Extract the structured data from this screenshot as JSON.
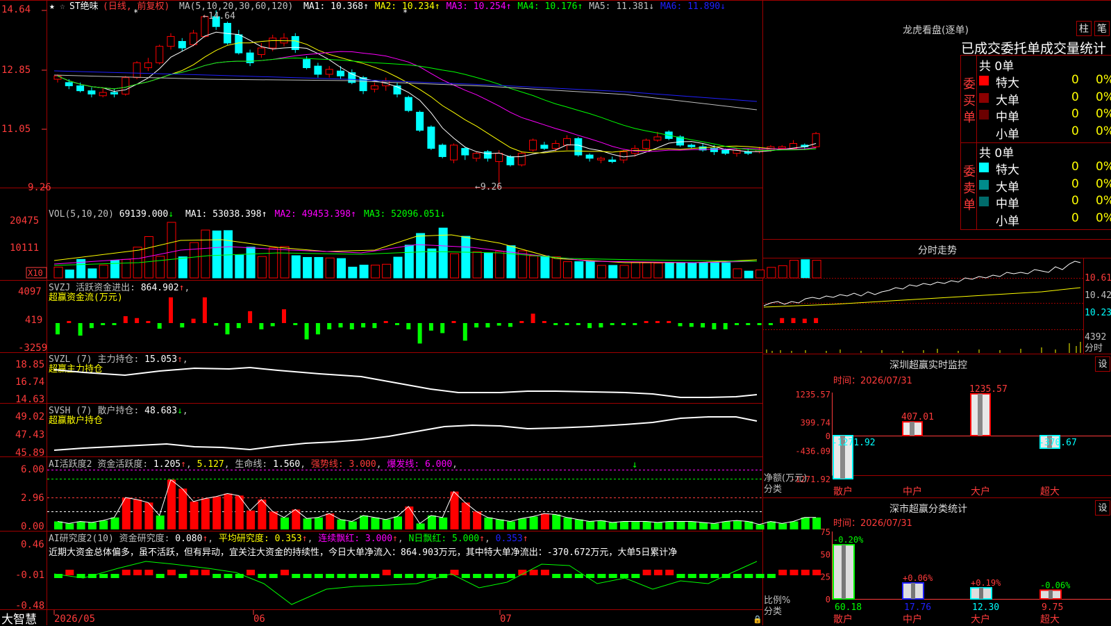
{
  "chart_data": {
    "type": "candlestick",
    "title": "ST绝味",
    "period": "日线",
    "adjust": "前复权",
    "y_ticks": [
      "14.64",
      "12.85",
      "11.05",
      "9.26"
    ],
    "high_label": "←14.64",
    "low_label": "←9.26",
    "x_ticks": [
      "2026/05",
      "06",
      "07"
    ],
    "candles": [
      [
        12.55,
        12.65,
        12.7,
        12.45
      ],
      [
        12.45,
        12.35,
        12.55,
        12.25
      ],
      [
        12.35,
        12.2,
        12.45,
        12.15
      ],
      [
        12.2,
        12.1,
        12.3,
        12.0
      ],
      [
        12.05,
        12.15,
        12.3,
        12.0
      ],
      [
        12.15,
        12.1,
        12.25,
        12.0
      ],
      [
        12.1,
        12.6,
        12.65,
        12.05
      ],
      [
        12.6,
        13.05,
        13.1,
        12.55
      ],
      [
        12.9,
        13.05,
        13.2,
        12.8
      ],
      [
        13.05,
        13.55,
        13.6,
        13.0
      ],
      [
        13.55,
        13.85,
        13.95,
        13.45
      ],
      [
        13.7,
        13.5,
        13.8,
        13.4
      ],
      [
        13.6,
        13.95,
        14.05,
        13.55
      ],
      [
        13.85,
        14.45,
        14.5,
        13.8
      ],
      [
        14.45,
        14.15,
        14.64,
        14.05
      ],
      [
        14.25,
        13.65,
        14.3,
        13.6
      ],
      [
        13.9,
        13.35,
        14.05,
        13.3
      ],
      [
        13.35,
        13.05,
        13.45,
        12.95
      ],
      [
        13.3,
        13.5,
        13.65,
        13.2
      ],
      [
        13.5,
        13.8,
        13.9,
        13.4
      ],
      [
        13.65,
        13.8,
        13.95,
        13.55
      ],
      [
        13.85,
        13.45,
        13.95,
        13.35
      ],
      [
        13.15,
        12.9,
        13.25,
        12.85
      ],
      [
        12.95,
        12.7,
        13.05,
        12.6
      ],
      [
        12.7,
        12.85,
        12.95,
        12.6
      ],
      [
        12.8,
        12.65,
        12.95,
        12.55
      ],
      [
        12.75,
        12.45,
        12.85,
        12.4
      ],
      [
        12.6,
        12.2,
        12.65,
        12.1
      ],
      [
        12.25,
        12.35,
        12.45,
        12.15
      ],
      [
        12.35,
        12.5,
        12.6,
        12.2
      ],
      [
        12.35,
        12.1,
        12.45,
        12.0
      ],
      [
        12.0,
        11.6,
        12.05,
        11.55
      ],
      [
        11.55,
        11.0,
        11.6,
        10.95
      ],
      [
        11.1,
        10.45,
        11.15,
        10.4
      ],
      [
        10.55,
        10.2,
        10.6,
        10.15
      ],
      [
        10.1,
        10.55,
        10.6,
        10.0
      ],
      [
        10.45,
        10.25,
        10.5,
        10.1
      ],
      [
        10.15,
        10.3,
        10.35,
        10.05
      ],
      [
        10.35,
        10.15,
        10.4,
        10.05
      ],
      [
        10.05,
        10.3,
        10.4,
        9.26
      ],
      [
        10.2,
        9.95,
        10.25,
        9.9
      ],
      [
        9.95,
        10.3,
        10.35,
        9.9
      ],
      [
        10.4,
        10.7,
        10.75,
        10.35
      ],
      [
        10.55,
        10.45,
        10.65,
        10.4
      ],
      [
        10.45,
        10.6,
        10.7,
        10.35
      ],
      [
        10.55,
        10.75,
        10.85,
        10.4
      ],
      [
        10.75,
        10.25,
        10.8,
        10.2
      ],
      [
        10.25,
        10.15,
        10.3,
        10.05
      ],
      [
        10.1,
        10.15,
        10.2,
        10.0
      ],
      [
        10.1,
        10.05,
        10.2,
        10.0
      ],
      [
        10.1,
        10.35,
        10.4,
        10.0
      ],
      [
        10.3,
        10.45,
        10.55,
        10.2
      ],
      [
        10.45,
        10.7,
        10.75,
        10.4
      ],
      [
        10.7,
        10.8,
        10.95,
        10.65
      ],
      [
        10.95,
        10.75,
        11.0,
        10.7
      ],
      [
        10.8,
        10.55,
        10.85,
        10.5
      ],
      [
        10.55,
        10.5,
        10.6,
        10.45
      ],
      [
        10.5,
        10.4,
        10.6,
        10.35
      ],
      [
        10.45,
        10.35,
        10.55,
        10.25
      ],
      [
        10.4,
        10.3,
        10.45,
        10.25
      ],
      [
        10.3,
        10.4,
        10.45,
        10.2
      ],
      [
        10.35,
        10.3,
        10.45,
        10.25
      ],
      [
        10.35,
        10.4,
        10.5,
        10.3
      ],
      [
        10.4,
        10.5,
        10.55,
        10.35
      ],
      [
        10.45,
        10.5,
        10.55,
        10.4
      ],
      [
        10.45,
        10.6,
        10.7,
        10.45
      ],
      [
        10.55,
        10.5,
        10.6,
        10.4
      ],
      [
        10.5,
        10.9,
        10.95,
        10.45
      ]
    ],
    "ma_header": "MA(5,10,20,30,60,120)",
    "ma": [
      {
        "name": "MA1",
        "value": "10.368",
        "arrow": "↑",
        "color": "#ffffff"
      },
      {
        "name": "MA2",
        "value": "10.234",
        "arrow": "↑",
        "color": "#ffff00"
      },
      {
        "name": "MA3",
        "value": "10.254",
        "arrow": "↑",
        "color": "#ff00ff"
      },
      {
        "name": "MA4",
        "value": "10.176",
        "arrow": "↑",
        "color": "#00ff00"
      },
      {
        "name": "MA5",
        "value": "11.381",
        "arrow": "↓",
        "color": "#c0c0c0"
      },
      {
        "name": "MA6",
        "value": "11.890",
        "arrow": "↓",
        "color": "#2020ff"
      }
    ],
    "vol": {
      "header": "VOL(5,10,20)",
      "value": "69139.000",
      "arrow": "↓",
      "ma": [
        {
          "name": "MA1",
          "value": "53038.398",
          "arrow": "↑",
          "color": "#ffffff"
        },
        {
          "name": "MA2",
          "value": "49453.398",
          "arrow": "↑",
          "color": "#ff00ff"
        },
        {
          "name": "MA3",
          "value": "52096.051",
          "arrow": "↓",
          "color": "#00ff00"
        }
      ],
      "y_ticks": [
        "20475",
        "10111"
      ],
      "unit": "X10",
      "values": [
        3800,
        2800,
        6500,
        3200,
        4500,
        6200,
        6500,
        10800,
        14500,
        7600,
        19500,
        7400,
        12400,
        16800,
        16500,
        16600,
        8000,
        10800,
        7500,
        10600,
        11000,
        7800,
        7200,
        7200,
        7000,
        6800,
        3800,
        4500,
        4500,
        4800,
        7300,
        11500,
        15600,
        10200,
        17500,
        8500,
        14600,
        9200,
        8800,
        9300,
        11300,
        9500,
        7700,
        7700,
        7400,
        5700,
        5700,
        5800,
        4400,
        4400,
        4400,
        5600,
        5300,
        5200,
        5300,
        5300,
        5300,
        5300,
        5300,
        5300,
        3200,
        2400,
        2800,
        3700,
        4300,
        6200,
        6400,
        6200
      ]
    },
    "svzj": {
      "header": "SVZJ",
      "label": "活跃资金进出",
      "value": "864.902",
      "arrow": "↑",
      "subtitle": "超赢资金流(万元)",
      "y_ticks": [
        "4097",
        "419",
        "-3259"
      ],
      "values": [
        -1800,
        0,
        -2000,
        -800,
        -200,
        -300,
        1100,
        800,
        0,
        -900,
        4097,
        -700,
        700,
        4097,
        -400,
        -1800,
        -800,
        1900,
        -1000,
        -500,
        2200,
        -300,
        -2600,
        -1800,
        -1000,
        -700,
        -1000,
        -700,
        -800,
        0,
        -300,
        -1000,
        -3259,
        -1200,
        -1600,
        0,
        -2800,
        -700,
        -700,
        -400,
        -600,
        0,
        1500,
        0,
        -200,
        -200,
        -100,
        -800,
        -700,
        -300,
        -200,
        -200,
        0,
        0,
        0,
        -500,
        -600,
        -700,
        -1000,
        -1000,
        -300,
        -200,
        -200,
        -200,
        800,
        800,
        700,
        800
      ]
    },
    "svzl": {
      "header": "SVZL (7)",
      "label": "主力持仓",
      "value": "15.053",
      "arrow": "↑",
      "subtitle": "超赢主力持仓",
      "y_ticks": [
        "18.85",
        "16.74",
        "14.63"
      ]
    },
    "svsh": {
      "header": "SVSH (7)",
      "label": "散户持仓",
      "value": "48.683",
      "arrow": "↓",
      "subtitle": "超赢散户持仓",
      "y_ticks": [
        "49.02",
        "47.43",
        "45.89"
      ]
    },
    "ai_active": {
      "header": "AI活跃度2",
      "label": "资金活跃度",
      "value1": "1.205",
      "value2": "5.127",
      "life_label": "生命线",
      "life_value": "1.560",
      "strong_label": "强势线",
      "strong_value": "3.000",
      "burst_label": "爆发线",
      "burst_value": "6.000",
      "y_ticks": [
        "6.00",
        "2.96",
        "0.00"
      ],
      "values": [
        0.8,
        0.6,
        0.8,
        0.7,
        0.9,
        1.2,
        3.2,
        3.0,
        2.7,
        1.4,
        5.0,
        4.1,
        2.8,
        3.1,
        3.3,
        3.6,
        3.4,
        1.9,
        3.0,
        1.8,
        1.2,
        2.0,
        1.1,
        1.2,
        1.6,
        1.0,
        0.8,
        1.4,
        1.2,
        1.0,
        1.3,
        2.3,
        0.6,
        1.4,
        1.2,
        3.8,
        2.7,
        1.8,
        1.2,
        1.0,
        0.8,
        1.1,
        1.3,
        1.6,
        1.5,
        1.2,
        1.0,
        0.8,
        0.9,
        0.7,
        0.8,
        0.8,
        0.8,
        0.7,
        0.8,
        0.8,
        0.8,
        0.7,
        0.6,
        0.8,
        0.9,
        0.8,
        0.5,
        0.8,
        0.6,
        0.8,
        1.2,
        1.2
      ]
    },
    "ai_research": {
      "header": "AI研究度2(10)",
      "label": "资金研究度",
      "value": "0.080",
      "avg_label": "平均研究度",
      "avg_value": "0.353",
      "streak_label": "连续飘红",
      "streak_value": "3.000",
      "nday_label": "N日飘红",
      "nday_value": "5.000",
      "last_value": "0.353",
      "y_ticks": [
        "0.46",
        "-0.01",
        "-0.48"
      ],
      "comment": "近期大资金总体偏多，虽不活跃，但有异动，宜关注大资金的持续性，今日大单净流入：864.903万元，其中特大单净流出：-370.672万元，大单5日累计净"
    }
  },
  "right": {
    "lhkp": {
      "title": "龙虎看盘(逐单)",
      "btn_bar": "柱",
      "btn_tick": "笔",
      "subtitle": "已成交委托单成交量统计",
      "buy": {
        "label": "委买单",
        "total": "共 0单",
        "rows": [
          {
            "name": "特大",
            "qty": "0",
            "pct": "0%",
            "color": "#ff0000"
          },
          {
            "name": "大单",
            "qty": "0",
            "pct": "0%",
            "color": "#8b0000"
          },
          {
            "name": "中单",
            "qty": "0",
            "pct": "0%",
            "color": "#6b0000"
          },
          {
            "name": "小单",
            "qty": "0",
            "pct": "0%",
            "color": "#000000"
          }
        ]
      },
      "sell": {
        "label": "委卖单",
        "total": "共 0单",
        "rows": [
          {
            "name": "特大",
            "qty": "0",
            "pct": "0%",
            "color": "#00ffff"
          },
          {
            "name": "大单",
            "qty": "0",
            "pct": "0%",
            "color": "#008b8b"
          },
          {
            "name": "中单",
            "qty": "0",
            "pct": "0%",
            "color": "#006b6b"
          },
          {
            "name": "小单",
            "qty": "0",
            "pct": "0%",
            "color": "#000000"
          }
        ]
      }
    },
    "intraday": {
      "title": "分时走势",
      "y_ticks": [
        "10.61",
        "10.42",
        "10.23"
      ],
      "vol_tick": "4392",
      "vol_unit": "分时"
    },
    "monitor": {
      "title": "深圳超赢实时监控",
      "set": "设",
      "time_label": "时间：",
      "time": "2026/07/31",
      "y_ticks": [
        "1235.57",
        "399.74",
        "0",
        "-436.09",
        "-1271.92"
      ],
      "axis_label": "净额(万元)",
      "cat_label": "分类",
      "bars": [
        {
          "cat": "散户",
          "value": -1271.92,
          "label": "-1271.92"
        },
        {
          "cat": "中户",
          "value": 407.01,
          "label": "407.01"
        },
        {
          "cat": "大户",
          "value": 1235.57,
          "label": "1235.57"
        },
        {
          "cat": "超大",
          "value": -370.67,
          "label": "-370.67"
        }
      ]
    },
    "classify": {
      "title": "深市超赢分类统计",
      "set": "设",
      "time_label": "时间：",
      "time": "2026/07/31",
      "y_ticks": [
        "75",
        "50",
        "25",
        "0"
      ],
      "axis_label": "比例%",
      "cat_label": "分类",
      "bars": [
        {
          "cat": "散户",
          "value": 60.18,
          "label": "60.18",
          "chg": "-0.20%"
        },
        {
          "cat": "中户",
          "value": 17.76,
          "label": "17.76",
          "chg": "+0.06%"
        },
        {
          "cat": "大户",
          "value": 12.3,
          "label": "12.30",
          "chg": "+0.19%"
        },
        {
          "cat": "超大",
          "value": 9.75,
          "label": "9.75",
          "chg": "-0.06%"
        }
      ]
    }
  },
  "brand": "大智慧",
  "colors": {
    "up": "#ff0000",
    "down": "#00ffff",
    "vol_down": "#00ffff",
    "grid": "#a00000",
    "label_red": "#ff3b3b",
    "yellow": "#ffff00"
  }
}
